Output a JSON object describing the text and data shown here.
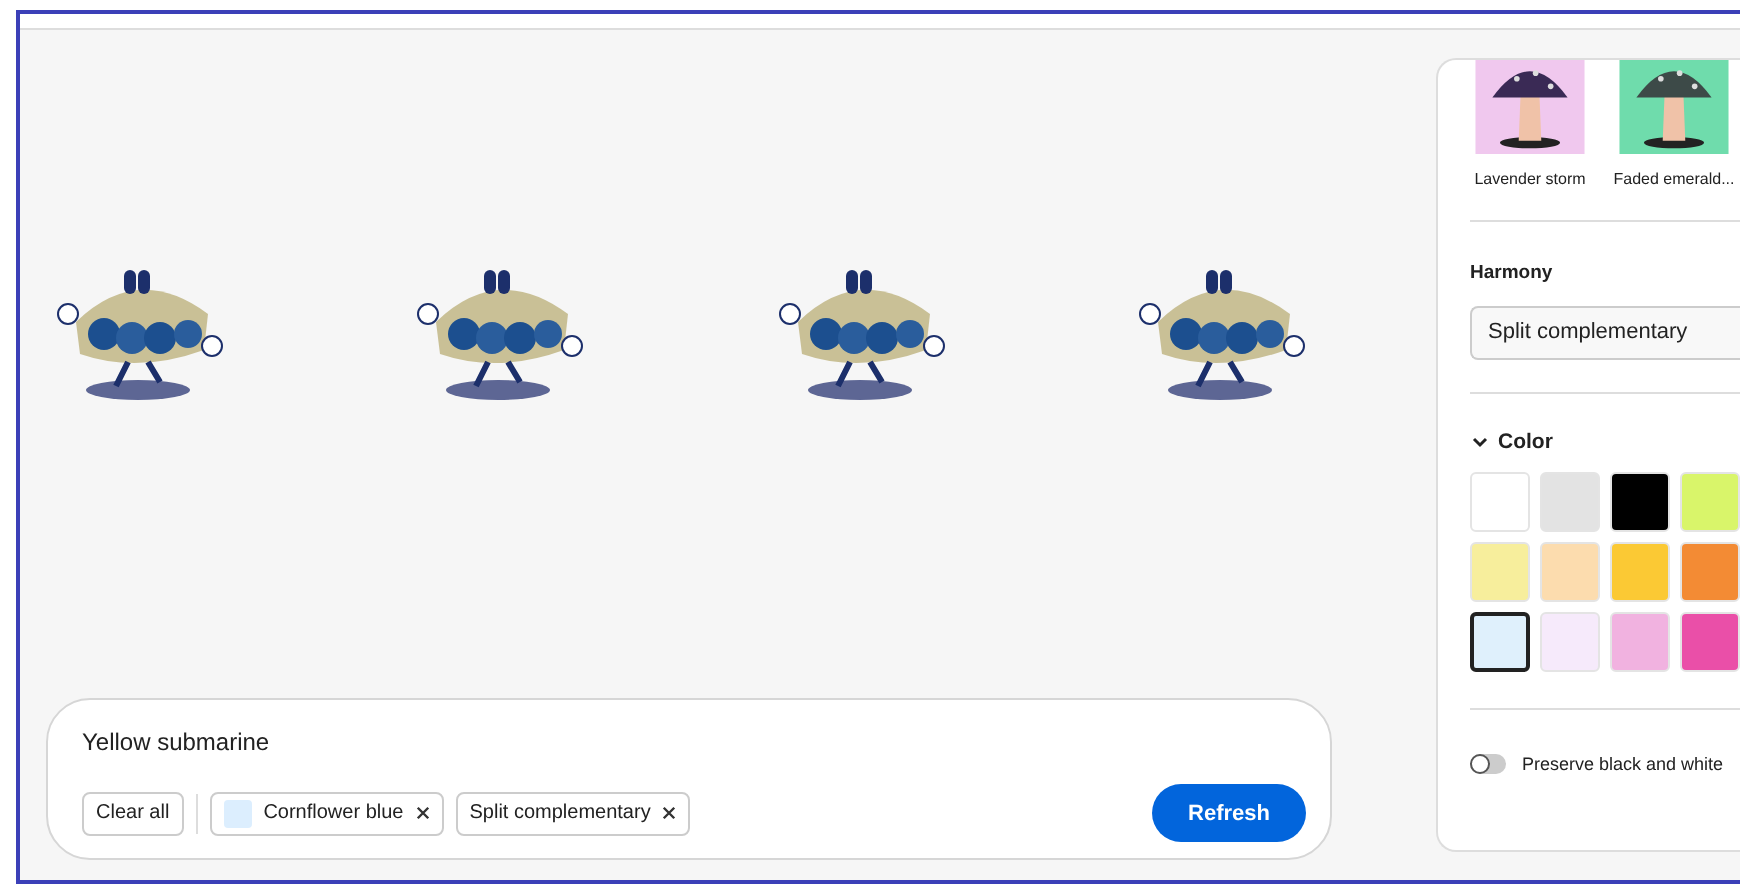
{
  "prompt": {
    "text": "Yellow submarine",
    "clear": "Clear all",
    "chips": [
      {
        "label": "Cornflower blue",
        "color": "#dceefe"
      },
      {
        "label": "Split complementary"
      }
    ],
    "button": "Refresh"
  },
  "styles": [
    {
      "label": "Lavender storm",
      "kind": "picture"
    },
    {
      "label": "Faded emerald...",
      "kind": "picture"
    }
  ],
  "harmony": {
    "label": "Harmony",
    "value": "Split complementary"
  },
  "color": {
    "label": "Color",
    "expanded": true,
    "swatches": [
      {
        "color": "#ffffff",
        "selected": false
      },
      {
        "color": "#e3e3e3",
        "selected": false
      },
      {
        "color": "#000000",
        "selected": false
      },
      {
        "color": "#d9f56a",
        "selected": false
      },
      {
        "color": "#f7ee9c",
        "selected": false
      },
      {
        "color": "#fcdcae",
        "selected": false
      },
      {
        "color": "#fbc934",
        "selected": false
      },
      {
        "color": "#f38b34",
        "selected": false
      },
      {
        "color": "#dff0fc",
        "selected": true
      },
      {
        "color": "#f6eafb",
        "selected": false
      },
      {
        "color": "#f1b2e0",
        "selected": false
      },
      {
        "color": "#ea4fa8",
        "selected": false
      }
    ]
  },
  "preserve": {
    "label": "Preserve black and white",
    "on": false
  }
}
